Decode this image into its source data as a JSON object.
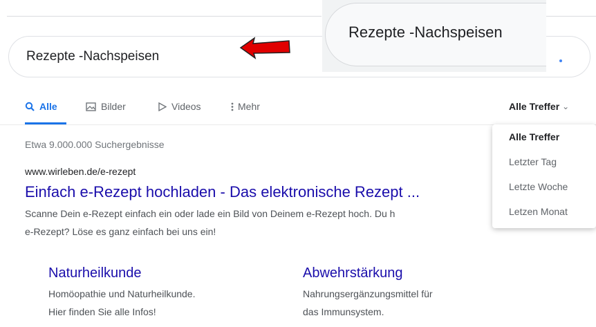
{
  "search": {
    "query": "Rezepte -Nachspeisen"
  },
  "zoom": {
    "text": "Rezepte -Nachspeisen"
  },
  "tabs": [
    {
      "label": "Alle",
      "icon": "search-icon"
    },
    {
      "label": "Bilder",
      "icon": "image-icon"
    },
    {
      "label": "Videos",
      "icon": "play-icon"
    },
    {
      "label": "Mehr",
      "icon": "more-vertical-icon"
    }
  ],
  "tools": {
    "label": "Alle Treffer"
  },
  "dropdown": {
    "items": [
      "Alle Treffer",
      "Letzter Tag",
      "Letzte Woche",
      "Letzen Monat"
    ]
  },
  "stats": "Etwa 9.000.000 Suchergebnisse",
  "result": {
    "url": "www.wirleben.de/e-rezept",
    "title": "Einfach e-Rezept hochladen - Das elektronische Rezept ...",
    "snippet_line1": "Scanne Dein e-Rezept einfach ein oder lade ein Bild von Deinem e-Rezept hoch. Du h",
    "snippet_line2": "e-Rezept? Löse es ganz einfach bei uns ein!",
    "sitelinks": [
      {
        "title": "Naturheilkunde",
        "line1": "Homöopathie und Naturheilkunde.",
        "line2": "Hier finden Sie alle Infos!"
      },
      {
        "title": "Abwehrstärkung",
        "line1": "Nahrungsergänzungsmittel für",
        "line2": "das Immunsystem."
      }
    ]
  },
  "colors": {
    "link": "#1a0dab",
    "accent": "#1a73e8",
    "arrow": "#e00000"
  }
}
